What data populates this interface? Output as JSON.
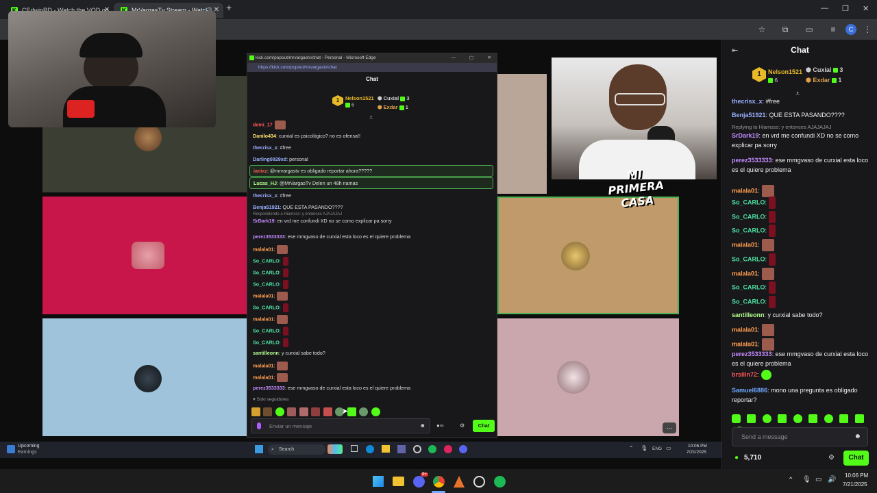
{
  "browser": {
    "tabs": [
      {
        "title": "CEdwinRD - Watch the VOD on"
      },
      {
        "title": "MrVargasTv Stream - Watch"
      }
    ],
    "new_tab": "+",
    "window_controls": [
      "—",
      "❐",
      "✕"
    ]
  },
  "popout": {
    "title": "kick.com/popout/mrvargastv/chat - Personal - Microsoft Edge",
    "url": "https://kick.com/popout/mrvargastv/chat",
    "chat_title": "Chat",
    "leaders": [
      {
        "name": "Nelson1521",
        "count": "6",
        "rank": "1"
      },
      {
        "name": "Cuxial",
        "count": "3"
      },
      {
        "name": "Exdar",
        "count": "1"
      }
    ],
    "messages": [
      {
        "user": "demi_17",
        "text": "",
        "color": "#ff5555",
        "emote": true
      },
      {
        "user": "Danilo434",
        "text": ": curxial es psicológico? no es ofensa!!",
        "color": "#ffe36b"
      },
      {
        "user": "thecrisx_x",
        "text": ": #free",
        "color": "#9ab0ff"
      },
      {
        "user": "Darling0929xd",
        "text": ": personal",
        "color": "#9ab0ff"
      },
      {
        "user": "ianixz",
        "text": ": @mrvargastv es obligado reportar ahora?????",
        "color": "#ff5555",
        "highlight": true
      },
      {
        "user": "Lucas_HJ",
        "text": ": @MrVargasTv Delen un 48h namas",
        "color": "#b4ff8f",
        "highlight": true
      },
      {
        "user": "thecrisx_x",
        "text": ": #free",
        "color": "#9ab0ff"
      },
      {
        "user": "Benja51921",
        "text": ": QUE ESTA PASANDO????",
        "color": "#9ab0ff"
      },
      {
        "user": "SrDark19",
        "text": ": en vrd me confundi XD no se como explicar pa sorry",
        "color": "#c58bff",
        "reply": "Respondiendo a Hiamsss: y entonces AJAJAJAJ"
      },
      {
        "user": "perez3533333",
        "text": ": ese mmgvaso de curxial esta loco es el quiere problema",
        "color": "#c58bff"
      },
      {
        "user": "malala01",
        "text": ":",
        "color": "#ff9d4d",
        "emote": true
      },
      {
        "user": "So_CARLO",
        "text": ":",
        "color": "#4de0a0",
        "emote": true
      },
      {
        "user": "So_CARLO",
        "text": ":",
        "color": "#4de0a0",
        "emote": true
      },
      {
        "user": "So_CARLO",
        "text": ":",
        "color": "#4de0a0",
        "emote": true
      },
      {
        "user": "malala01",
        "text": ":",
        "color": "#ff9d4d",
        "emote": true
      },
      {
        "user": "So_CARLO",
        "text": ":",
        "color": "#4de0a0",
        "emote": true
      },
      {
        "user": "malala01",
        "text": ":",
        "color": "#ff9d4d",
        "emote": true
      },
      {
        "user": "So_CARLO",
        "text": ":",
        "color": "#4de0a0",
        "emote": true
      },
      {
        "user": "So_CARLO",
        "text": ":",
        "color": "#4de0a0",
        "emote": true
      },
      {
        "user": "santilleonn",
        "text": ": y curxial sabe todo?",
        "color": "#b4ff8f"
      },
      {
        "user": "malala01",
        "text": ":",
        "color": "#ff9d4d",
        "emote": true
      },
      {
        "user": "malala01",
        "text": ":",
        "color": "#ff9d4d",
        "emote": true
      },
      {
        "user": "perez3533333",
        "text": ": ese mmgvaso de curxial esta loco es el quiere problema",
        "color": "#c58bff"
      }
    ],
    "followers_only": "Solo seguidores",
    "input_placeholder": "Enviar un mensaje",
    "chat_button": "Chat"
  },
  "sidebar_chat": {
    "title": "Chat",
    "leaders": [
      {
        "name": "Nelson1521",
        "count": "6",
        "rank": "1"
      },
      {
        "name": "Cuxial",
        "count": "3"
      },
      {
        "name": "Exdar",
        "count": "1"
      }
    ],
    "messages": [
      {
        "user": "thecrisx_x",
        "text": ": #free",
        "color": "#9ab0ff"
      },
      {
        "user": "Benja51921",
        "text": ": QUE ESTA PASANDO????",
        "color": "#9ab0ff"
      },
      {
        "reply": "Replying to Hiamsss: y entonces AJAJAJAJ",
        "user": "SrDark19",
        "text": ": en vrd me confundi XD no se como explicar pa sorry",
        "color": "#c58bff"
      },
      {
        "user": "perez3533333",
        "text": ": ese mmgvaso de curxial esta loco es el quiere problema",
        "color": "#c58bff"
      },
      {
        "user": "malala01",
        "text": ":",
        "color": "#ff9d4d",
        "emote": true
      },
      {
        "user": "So_CARLO",
        "text": ":",
        "color": "#4de0a0",
        "emote": true
      },
      {
        "user": "So_CARLO",
        "text": ":",
        "color": "#4de0a0",
        "emote": true
      },
      {
        "user": "So_CARLO",
        "text": ":",
        "color": "#4de0a0",
        "emote": true
      },
      {
        "user": "malala01",
        "text": ":",
        "color": "#ff9d4d",
        "emote": true
      },
      {
        "user": "So_CARLO",
        "text": ":",
        "color": "#4de0a0",
        "emote": true
      },
      {
        "user": "malala01",
        "text": ":",
        "color": "#ff9d4d",
        "emote": true
      },
      {
        "user": "So_CARLO",
        "text": ":",
        "color": "#4de0a0",
        "emote": true
      },
      {
        "user": "So_CARLO",
        "text": ":",
        "color": "#4de0a0",
        "emote": true
      },
      {
        "user": "santilleonn",
        "text": ": y curxial sabe todo?",
        "color": "#b4ff8f"
      },
      {
        "user": "malala01",
        "text": ":",
        "color": "#ff9d4d",
        "emote": true
      },
      {
        "user": "malala01",
        "text": ":",
        "color": "#ff9d4d",
        "emote": true
      },
      {
        "user": "perez3533333",
        "text": ": ese mmgvaso de curxial esta loco es el quiere problema",
        "color": "#c58bff"
      },
      {
        "user": "brsilin72",
        "text": ":",
        "color": "#ff5555",
        "emote": true
      },
      {
        "user": "Samuel6886",
        "text": ": mono una pregunta es obligado reportar?",
        "color": "#6fa8ff"
      }
    ],
    "input_placeholder": "Send a message",
    "points": "5,710",
    "chat_button": "Chat"
  },
  "overlay_text": "MI PRIMERA CASA",
  "inner_taskbar": {
    "widget_title": "Upcoming",
    "widget_sub": "Earnings",
    "search": "Search",
    "lang": "ENG",
    "time": "10:06 PM",
    "date": "7/21/2025"
  },
  "os_taskbar": {
    "time": "10:06 PM",
    "date": "7/21/2025",
    "discord_badge": "9+"
  },
  "colors": {
    "kick_green": "#53fc18",
    "chat_bg": "#18181b"
  }
}
